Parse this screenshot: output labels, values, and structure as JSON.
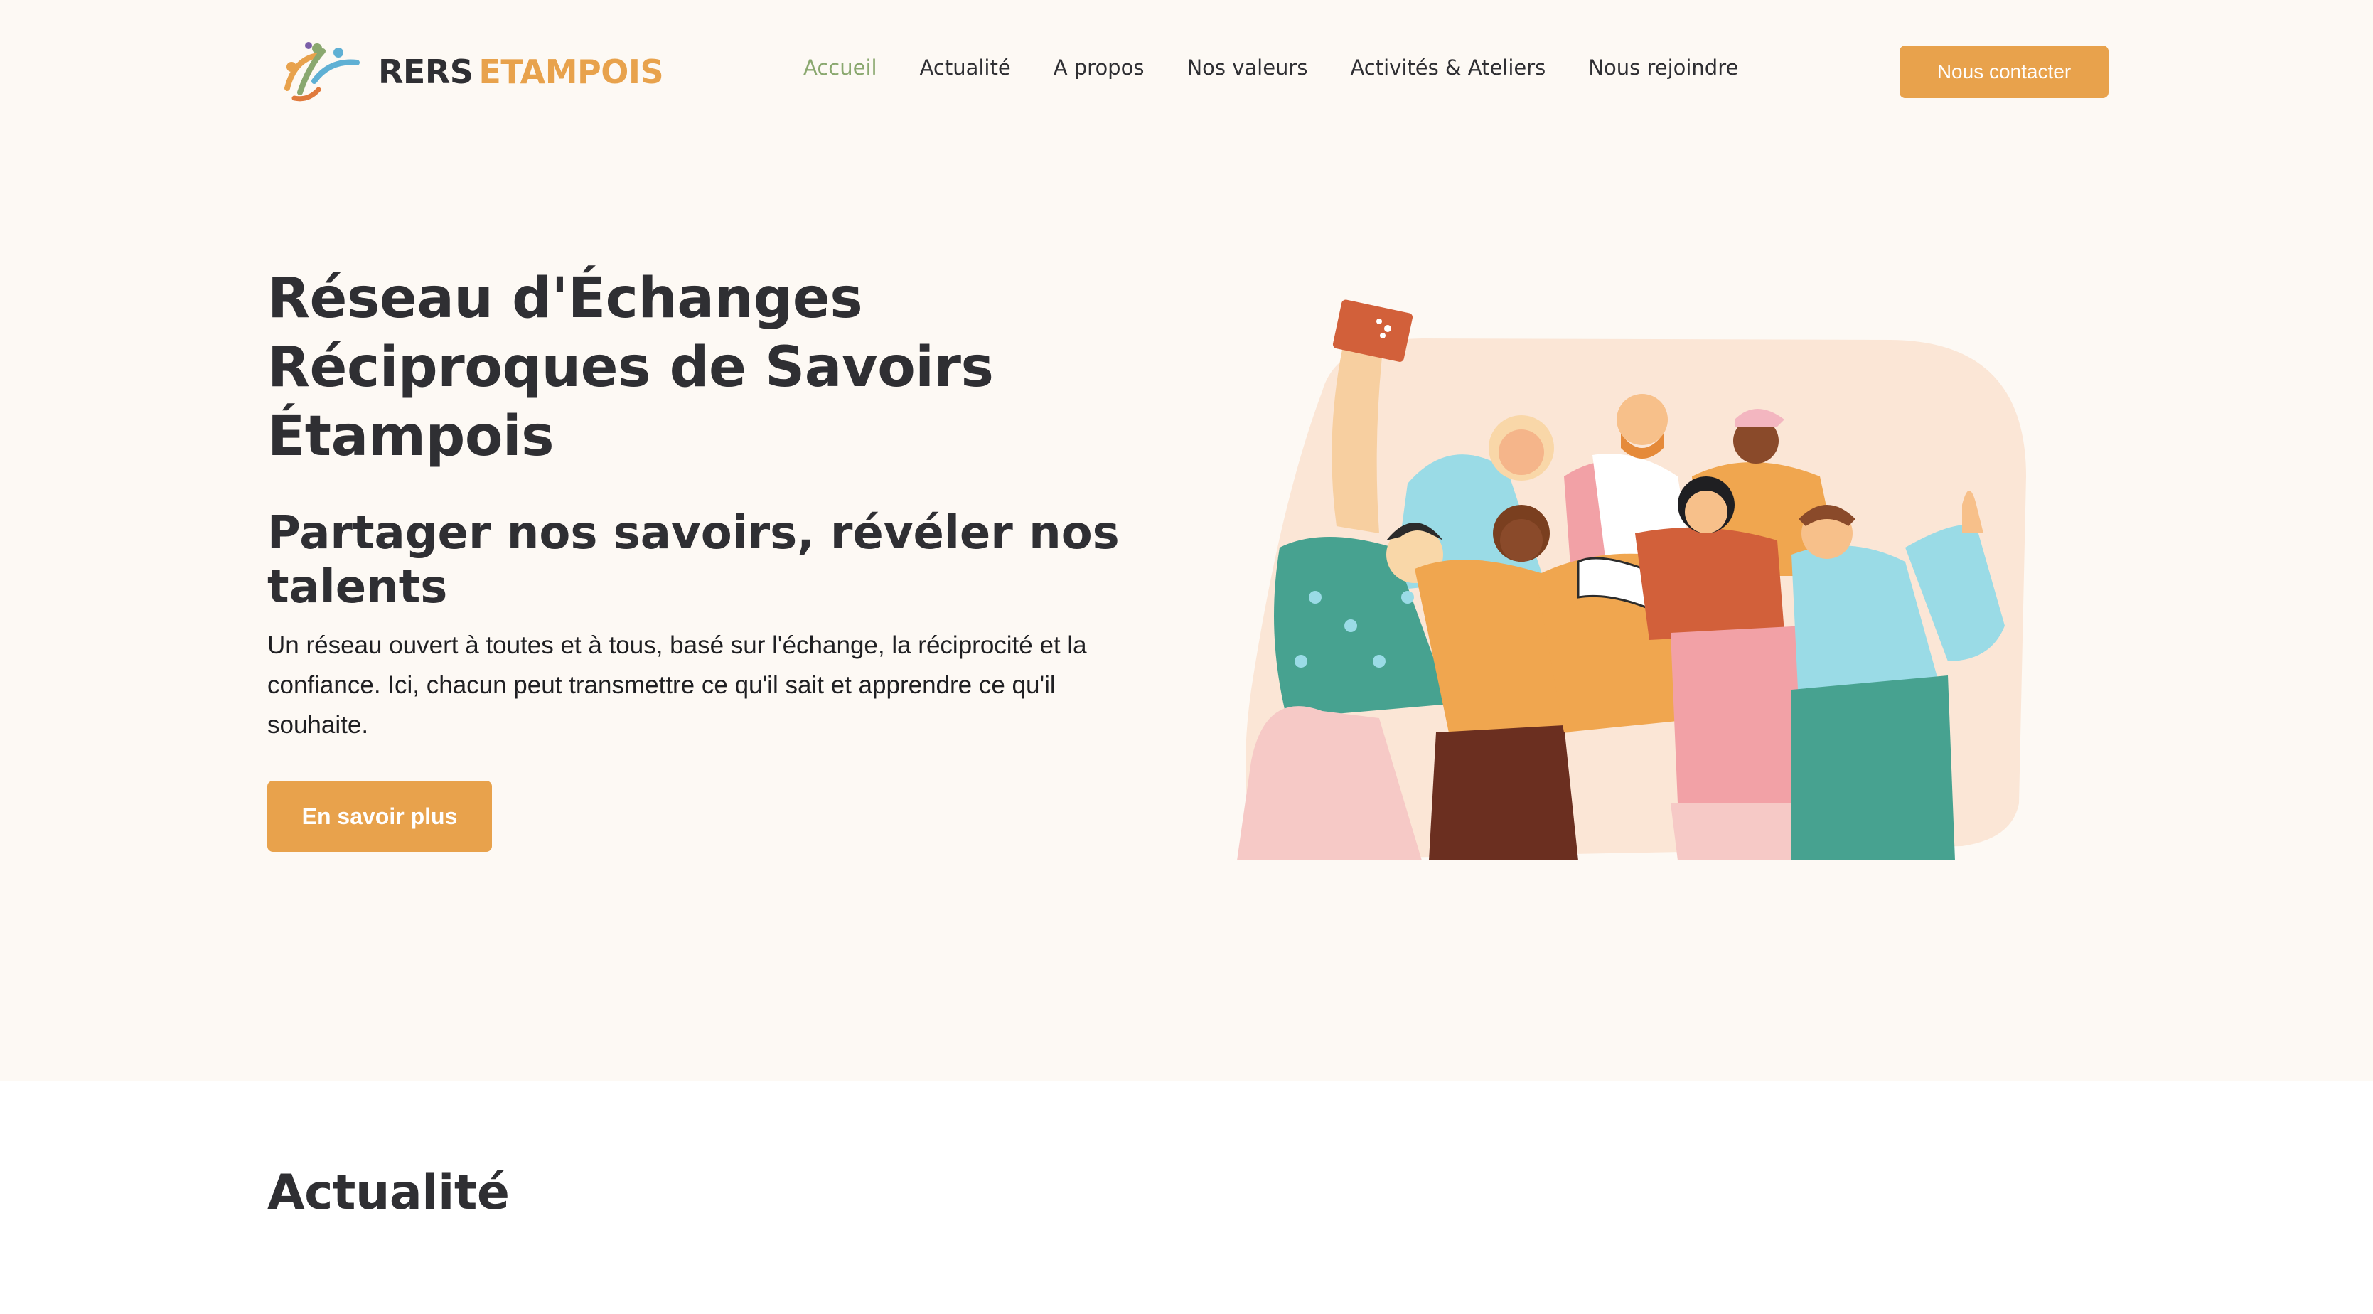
{
  "brand": {
    "name_part1": "RERS",
    "name_part2": "ETAMPOIS"
  },
  "nav": {
    "items": [
      {
        "label": "Accueil",
        "active": true
      },
      {
        "label": "Actualité",
        "active": false
      },
      {
        "label": "A propos",
        "active": false
      },
      {
        "label": "Nos valeurs",
        "active": false
      },
      {
        "label": "Activités & Ateliers",
        "active": false
      },
      {
        "label": "Nous rejoindre",
        "active": false
      }
    ],
    "contact_label": "Nous contacter"
  },
  "hero": {
    "title": "Réseau d'Échanges Réciproques de Savoirs Étampois",
    "subtitle": "Partager nos savoirs, révéler nos talents",
    "description": "Un réseau ouvert à toutes et à tous, basé sur l'échange, la réciprocité et la confiance. Ici, chacun peut transmettre ce qu'il sait et apprendre ce qu'il souhaite.",
    "cta_label": "En savoir plus",
    "illustration_icon": "group-of-people-illustration"
  },
  "news": {
    "title": "Actualité"
  },
  "colors": {
    "accent": "#e8a24c",
    "nav_active": "#8aa86f",
    "text": "#2f2f33",
    "background": "#fdf9f4"
  }
}
